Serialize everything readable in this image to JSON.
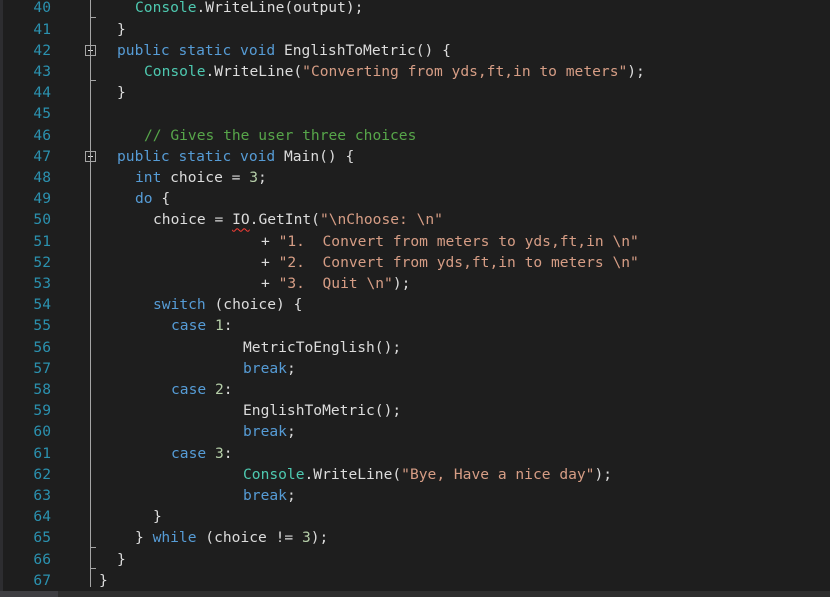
{
  "editor": {
    "first_line_number": 40,
    "colors": {
      "background": "#1e1e1e",
      "line_number": "#2b91af",
      "keyword": "#569cd6",
      "type": "#4ec9b0",
      "string": "#d69d85",
      "comment": "#57a64a",
      "number": "#b5cea8",
      "plain": "#dcdcdc",
      "error_squiggle": "#fc3e36"
    },
    "lines": [
      {
        "n": "40",
        "indent": 2,
        "tokens": [
          [
            "ty",
            "Console"
          ],
          [
            "pl",
            ".WriteLine(output);"
          ]
        ]
      },
      {
        "n": "41",
        "indent": 0,
        "tokens": [
          [
            "pl",
            "}"
          ]
        ]
      },
      {
        "n": "42",
        "indent": 0,
        "fold": true,
        "tokens": [
          [
            "kw",
            "public"
          ],
          [
            "pl",
            " "
          ],
          [
            "kw",
            "static"
          ],
          [
            "pl",
            " "
          ],
          [
            "kw",
            "void"
          ],
          [
            "pl",
            " EnglishToMetric() {"
          ]
        ]
      },
      {
        "n": "43",
        "indent": 3,
        "tokens": [
          [
            "ty",
            "Console"
          ],
          [
            "pl",
            ".WriteLine("
          ],
          [
            "st",
            "\"Converting from yds,ft,in to meters\""
          ],
          [
            "pl",
            ");"
          ]
        ]
      },
      {
        "n": "44",
        "indent": 0,
        "tokens": [
          [
            "pl",
            "}"
          ]
        ]
      },
      {
        "n": "45",
        "indent": 0,
        "tokens": []
      },
      {
        "n": "46",
        "indent": 3,
        "tokens": [
          [
            "cm",
            "// Gives the user three choices"
          ]
        ]
      },
      {
        "n": "47",
        "indent": 0,
        "fold": true,
        "tokens": [
          [
            "kw",
            "public"
          ],
          [
            "pl",
            " "
          ],
          [
            "kw",
            "static"
          ],
          [
            "pl",
            " "
          ],
          [
            "kw",
            "void"
          ],
          [
            "pl",
            " Main() {"
          ]
        ]
      },
      {
        "n": "48",
        "indent": 2,
        "tokens": [
          [
            "kw",
            "int"
          ],
          [
            "pl",
            " choice = "
          ],
          [
            "nu",
            "3"
          ],
          [
            "pl",
            ";"
          ]
        ]
      },
      {
        "n": "49",
        "indent": 2,
        "tokens": [
          [
            "kw",
            "do"
          ],
          [
            "pl",
            " {"
          ]
        ]
      },
      {
        "n": "50",
        "indent": 4,
        "tokens": [
          [
            "pl",
            "choice = "
          ],
          [
            "sq",
            "IO"
          ],
          [
            "pl",
            ".GetInt("
          ],
          [
            "st",
            "\"\\nChoose: \\n\""
          ]
        ]
      },
      {
        "n": "51",
        "indent": 16,
        "tokens": [
          [
            "pl",
            "+ "
          ],
          [
            "st",
            "\"1.  Convert from meters to yds,ft,in \\n\""
          ]
        ]
      },
      {
        "n": "52",
        "indent": 16,
        "tokens": [
          [
            "pl",
            "+ "
          ],
          [
            "st",
            "\"2.  Convert from yds,ft,in to meters \\n\""
          ]
        ]
      },
      {
        "n": "53",
        "indent": 16,
        "tokens": [
          [
            "pl",
            "+ "
          ],
          [
            "st",
            "\"3.  Quit \\n\""
          ],
          [
            "pl",
            ");"
          ]
        ]
      },
      {
        "n": "54",
        "indent": 4,
        "tokens": [
          [
            "kw",
            "switch"
          ],
          [
            "pl",
            " (choice) {"
          ]
        ]
      },
      {
        "n": "55",
        "indent": 6,
        "tokens": [
          [
            "kw",
            "case"
          ],
          [
            "pl",
            " "
          ],
          [
            "nu",
            "1"
          ],
          [
            "pl",
            ":"
          ]
        ]
      },
      {
        "n": "56",
        "indent": 14,
        "tokens": [
          [
            "pl",
            "MetricToEnglish();"
          ]
        ]
      },
      {
        "n": "57",
        "indent": 14,
        "tokens": [
          [
            "kw",
            "break"
          ],
          [
            "pl",
            ";"
          ]
        ]
      },
      {
        "n": "58",
        "indent": 6,
        "tokens": [
          [
            "kw",
            "case"
          ],
          [
            "pl",
            " "
          ],
          [
            "nu",
            "2"
          ],
          [
            "pl",
            ":"
          ]
        ]
      },
      {
        "n": "59",
        "indent": 14,
        "tokens": [
          [
            "pl",
            "EnglishToMetric();"
          ]
        ]
      },
      {
        "n": "60",
        "indent": 14,
        "tokens": [
          [
            "kw",
            "break"
          ],
          [
            "pl",
            ";"
          ]
        ]
      },
      {
        "n": "61",
        "indent": 6,
        "tokens": [
          [
            "kw",
            "case"
          ],
          [
            "pl",
            " "
          ],
          [
            "nu",
            "3"
          ],
          [
            "pl",
            ":"
          ]
        ]
      },
      {
        "n": "62",
        "indent": 14,
        "tokens": [
          [
            "ty",
            "Console"
          ],
          [
            "pl",
            ".WriteLine("
          ],
          [
            "st",
            "\"Bye, Have a nice day\""
          ],
          [
            "pl",
            ");"
          ]
        ]
      },
      {
        "n": "63",
        "indent": 14,
        "tokens": [
          [
            "kw",
            "break"
          ],
          [
            "pl",
            ";"
          ]
        ]
      },
      {
        "n": "64",
        "indent": 4,
        "tokens": [
          [
            "pl",
            "}"
          ]
        ]
      },
      {
        "n": "65",
        "indent": 2,
        "tokens": [
          [
            "pl",
            "} "
          ],
          [
            "kw",
            "while"
          ],
          [
            "pl",
            " (choice != "
          ],
          [
            "nu",
            "3"
          ],
          [
            "pl",
            ");"
          ]
        ]
      },
      {
        "n": "66",
        "indent": 0,
        "tokens": [
          [
            "pl",
            "}"
          ]
        ]
      },
      {
        "n": "67",
        "indent": -2,
        "tokens": [
          [
            "pl",
            "}"
          ]
        ]
      }
    ],
    "error": {
      "line": "50",
      "token": "IO",
      "kind": "red-squiggle"
    }
  },
  "scrollbar": {
    "horizontal": true
  }
}
